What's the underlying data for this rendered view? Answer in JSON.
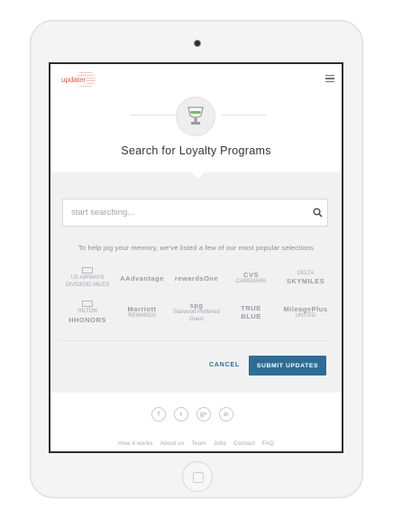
{
  "app": {
    "logo_text": "updater"
  },
  "hero": {
    "title": "Search for Loyalty Programs"
  },
  "search": {
    "placeholder": "start searching..."
  },
  "hint": "To help jog your memory, we've listed a few of our most popular selections",
  "brands": [
    [
      {
        "line1": "US AIRWAYS",
        "line2": "DIVIDEND MILES"
      },
      {
        "line1": "AAdvantage",
        "line2": ""
      },
      {
        "line1": "rewardsOne",
        "line2": ""
      },
      {
        "line1": "CVS",
        "line2": "CAREMARK"
      },
      {
        "line1": "SKYMILES",
        "line2": "DELTA"
      }
    ],
    [
      {
        "line1": "HILTON",
        "line2": "HHONORS"
      },
      {
        "line1": "Marriott",
        "line2": "REWARDS"
      },
      {
        "line1": "spg",
        "line2": "Starwood Preferred Guest"
      },
      {
        "line1": "TRUE",
        "line2": "BLUE"
      },
      {
        "line1": "MileagePlus",
        "line2": "UNITED"
      }
    ]
  ],
  "actions": {
    "cancel": "CANCEL",
    "submit": "SUBMIT UPDATES"
  },
  "social": [
    "f",
    "t",
    "g+",
    "in"
  ],
  "footer_links": [
    "How it works",
    "About us",
    "Team",
    "Jobs",
    "Contact",
    "FAQ"
  ],
  "colors": {
    "accent": "#2c6d96",
    "brand": "#e8553e",
    "trophy": "#6bbf5a"
  }
}
